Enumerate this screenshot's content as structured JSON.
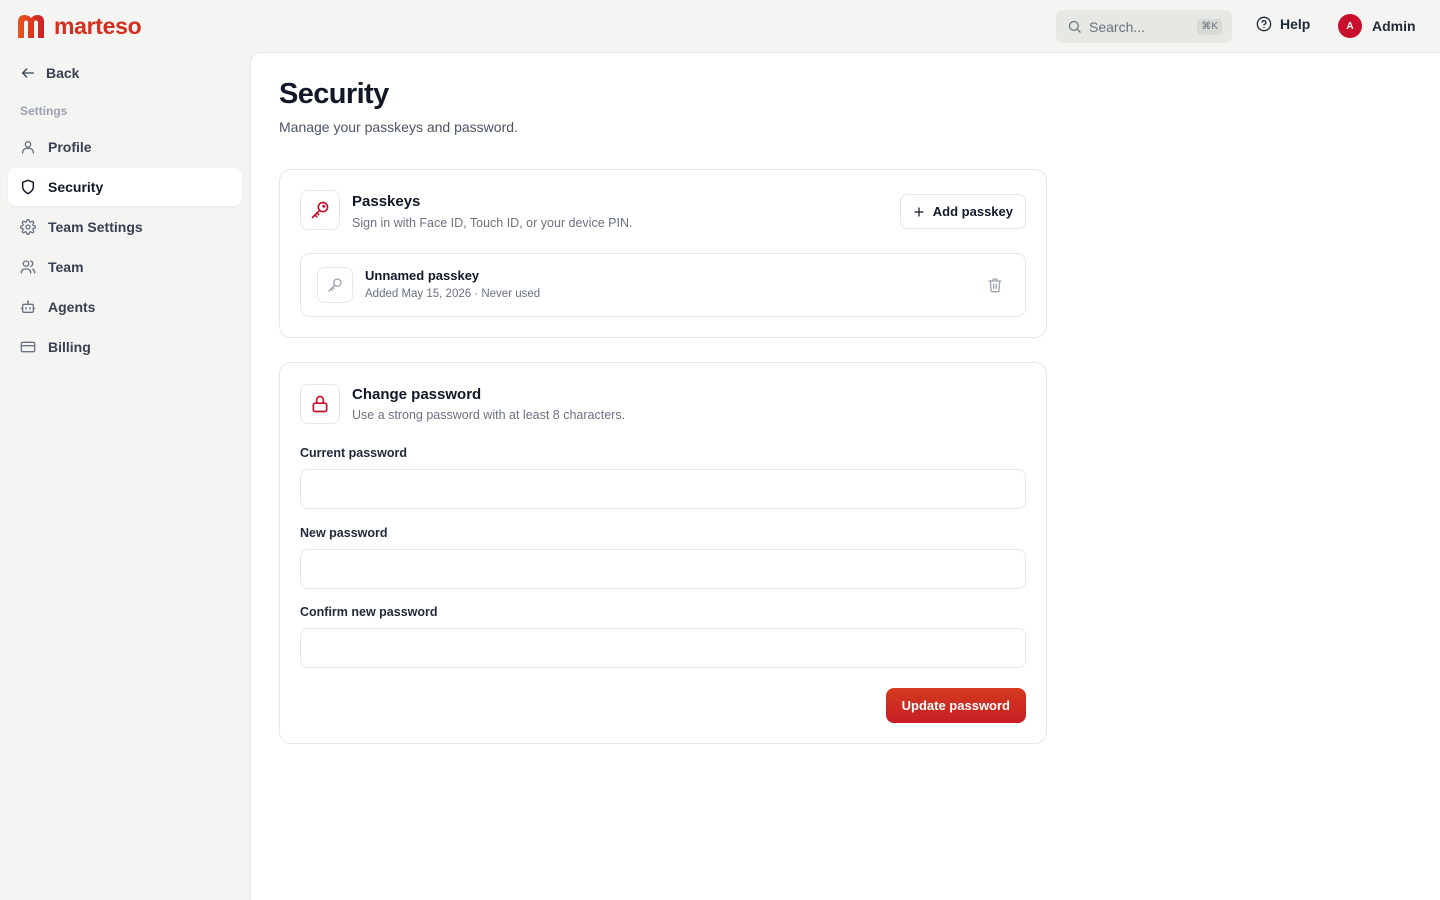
{
  "brand": {
    "name": "marteso",
    "color": "#d42f1e"
  },
  "topbar": {
    "search_placeholder": "Search...",
    "search_shortcut": "⌘K",
    "help_label": "Help",
    "user": {
      "initial": "A",
      "name": "Admin",
      "avatar_color": "#c8102e"
    }
  },
  "sidebar": {
    "back_label": "Back",
    "section_label": "Settings",
    "items": [
      {
        "label": "Profile",
        "icon": "user-icon",
        "active": false
      },
      {
        "label": "Security",
        "icon": "shield-icon",
        "active": true
      },
      {
        "label": "Team Settings",
        "icon": "gear-icon",
        "active": false
      },
      {
        "label": "Team",
        "icon": "users-icon",
        "active": false
      },
      {
        "label": "Agents",
        "icon": "bot-icon",
        "active": false
      },
      {
        "label": "Billing",
        "icon": "credit-card-icon",
        "active": false
      }
    ]
  },
  "page": {
    "title": "Security",
    "subtitle": "Manage your passkeys and password."
  },
  "passkeys": {
    "title": "Passkeys",
    "description": "Sign in with Face ID, Touch ID, or your device PIN.",
    "add_label": "Add passkey",
    "items": [
      {
        "name": "Unnamed passkey",
        "meta": "Added May 15, 2026 · Never used"
      }
    ]
  },
  "password": {
    "title": "Change password",
    "description": "Use a strong password with at least 8 characters.",
    "fields": [
      {
        "label": "Current password",
        "value": ""
      },
      {
        "label": "New password",
        "value": ""
      },
      {
        "label": "Confirm new password",
        "value": ""
      }
    ],
    "submit_label": "Update password"
  },
  "colors": {
    "accent": "#c8102e",
    "background": "#f4f5f2",
    "surface": "#ffffff"
  }
}
